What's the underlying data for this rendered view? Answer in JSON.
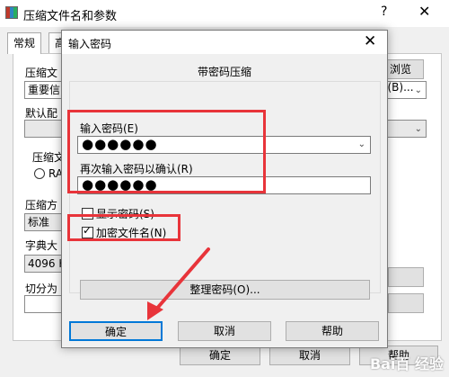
{
  "bg_window": {
    "title": "压缩文件名和参数",
    "help_glyph": "?",
    "close_glyph": "✕",
    "tabs": [
      "常规",
      "高"
    ],
    "archive_name_label": "压缩文",
    "archive_name_value": "重要信",
    "browse_button": "浏览(B)...",
    "default_profile_label": "默认配",
    "archive_format_label": "压缩文",
    "format_option": "RA",
    "compression_method_label": "压缩方",
    "compression_method_value": "标准",
    "dictionary_size_label": "字典大",
    "dictionary_size_value": "4096 K",
    "split_label": "切分为",
    "ok_button": "确定",
    "cancel_button": "取消",
    "help_button": "帮助"
  },
  "dialog": {
    "title": "输入密码",
    "close_glyph": "✕",
    "subtitle": "带密码压缩",
    "password_label": "输入密码(E)",
    "password_value": "●●●●●●",
    "confirm_label": "再次输入密码以确认(R)",
    "confirm_value": "●●●●●●",
    "show_password_label": "显示密码(S)",
    "encrypt_names_label": "加密文件名(N)",
    "check_mark": "✓",
    "organize_button": "整理密码(O)...",
    "ok_button": "确定",
    "cancel_button": "取消",
    "help_button": "帮助"
  },
  "watermark": "Bai百 经验",
  "colors": {
    "highlight": "#e8343a",
    "accent": "#0078d7"
  },
  "icons": [
    "winrar-icon",
    "chevron-down-icon",
    "close-icon",
    "help-icon",
    "arrow-annotation"
  ]
}
